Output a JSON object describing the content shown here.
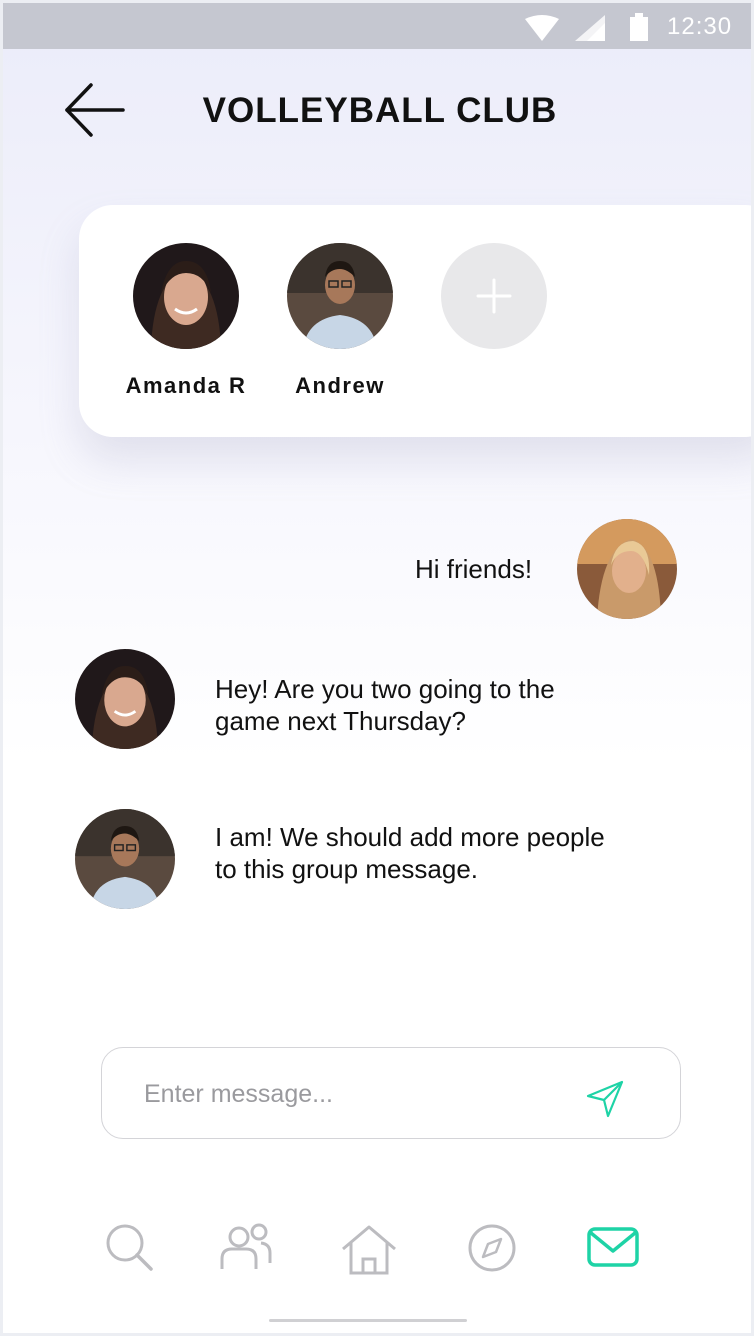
{
  "status_bar": {
    "time": "12:30"
  },
  "header": {
    "title": "VOLLEYBALL CLUB"
  },
  "members": [
    {
      "name": "Amanda R"
    },
    {
      "name": "Andrew"
    }
  ],
  "messages": [
    {
      "text": "Hi friends!"
    },
    {
      "text_line1": "Hey!  Are you two going to the",
      "text_line2": "game next Thursday?"
    },
    {
      "text_line1": "I am! We should add more people",
      "text_line2": "to this group message."
    }
  ],
  "composer": {
    "placeholder": "Enter message..."
  },
  "nav": {
    "items": [
      "search-icon",
      "people-icon",
      "home-icon",
      "compass-icon",
      "mail-icon"
    ],
    "active_color": "#1ed3a6",
    "inactive_color": "#bcbcc0"
  }
}
